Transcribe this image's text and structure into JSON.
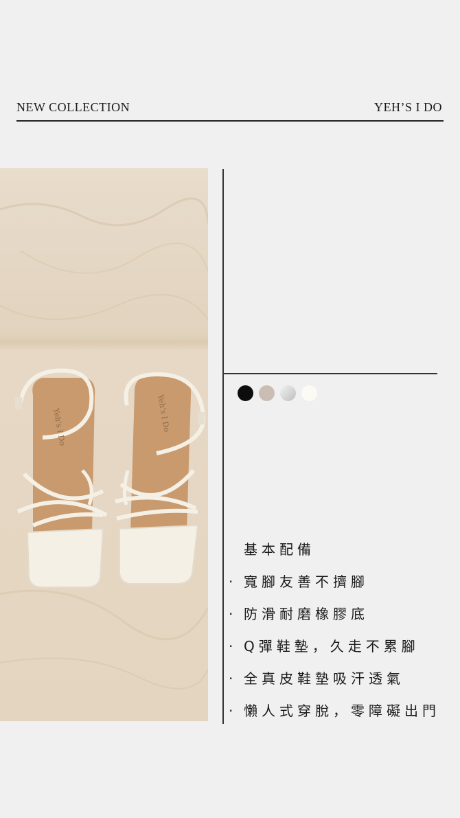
{
  "header": {
    "left_title": "NEW COLLECTION",
    "right_title": "YEH’S I DO"
  },
  "product": {
    "image_alt": "white strappy sandals on plywood",
    "insole_logo": "Yeh's I Do",
    "colors": [
      "#0d0d0d",
      "#cbbdb3",
      "#d8d8d8",
      "#f7f5ef"
    ]
  },
  "features": {
    "heading": "基本配備",
    "bullet": "·",
    "items": [
      "寬腳友善不擠腳",
      "防滑耐磨橡膠底",
      "Q彈鞋墊，久走不累腳",
      "全真皮鞋墊吸汗透氣",
      "懶人式穿脫，零障礙出門"
    ]
  }
}
